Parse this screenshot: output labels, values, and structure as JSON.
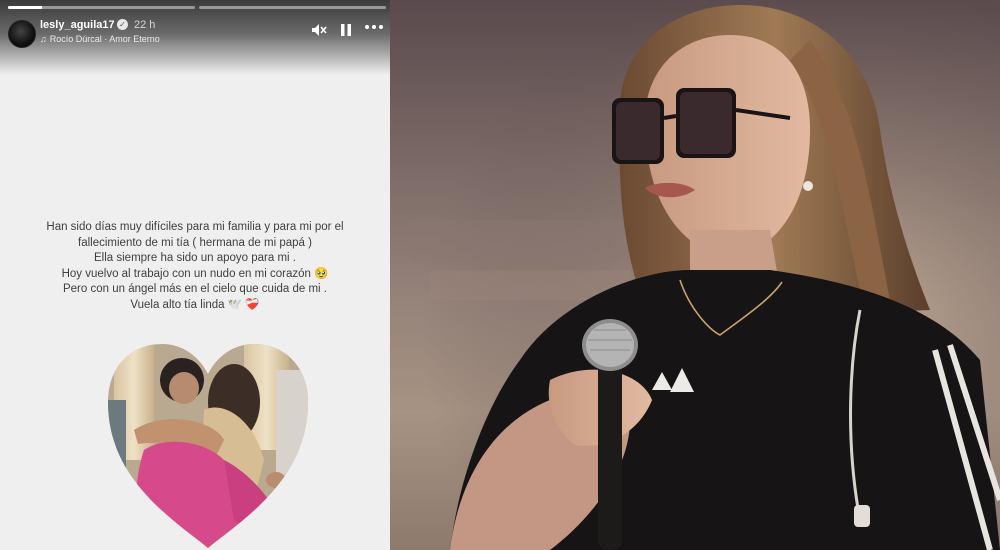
{
  "story": {
    "username": "lesly_aguila17",
    "time": "22 h",
    "music": "Rocío Dúrcal · Amor Eterno",
    "progress": {
      "segments": 2,
      "current_fraction": 0.18
    },
    "message_lines": [
      "Han sido días muy difíciles para mi familia y para mi por el",
      "fallecimiento de mi tía ( hermana de mi papá )",
      "Ella siempre ha sido un apoyo para mi .",
      "Hoy vuelvo al trabajo con un nudo en mi corazón 🥹",
      "Pero con un ángel más en el cielo que cuida de mi .",
      "Vuela alto tía linda 🕊️ ❤️‍🩹"
    ],
    "icons": {
      "mute": "speaker-muted-icon",
      "pause": "pause-icon",
      "more": "more-options-icon",
      "verified": "verified-badge-icon",
      "music": "music-note-icon"
    }
  },
  "photo": {
    "subject": "woman-with-sunglasses-holding-microphone"
  }
}
